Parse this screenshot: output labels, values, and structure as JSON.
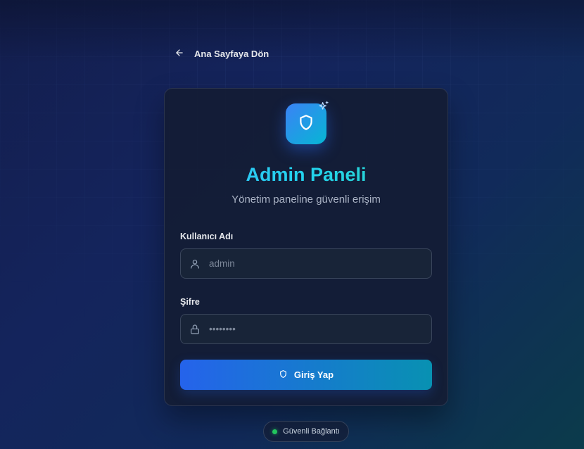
{
  "header": {
    "back_label": "Ana Sayfaya Dön"
  },
  "login": {
    "title": "Admin Paneli",
    "subtitle": "Yönetim paneline güvenli erişim",
    "username": {
      "label": "Kullanıcı Adı",
      "placeholder": "admin",
      "value": ""
    },
    "password": {
      "label": "Şifre",
      "placeholder": "••••••••",
      "value": ""
    },
    "submit_label": "Giriş Yap"
  },
  "footer": {
    "status_label": "Güvenli Bağlantı",
    "status_color": "#22c55e"
  },
  "icons": {
    "back": "arrow-left-icon",
    "logo": "shield-icon",
    "sparkle": "sparkles-icon",
    "username": "user-icon",
    "password": "lock-icon",
    "submit": "shield-icon"
  },
  "colors": {
    "accent_start": "#2563eb",
    "accent_end": "#0891b2",
    "title_gradient": [
      "#38bdf8",
      "#2dd4bf"
    ]
  }
}
